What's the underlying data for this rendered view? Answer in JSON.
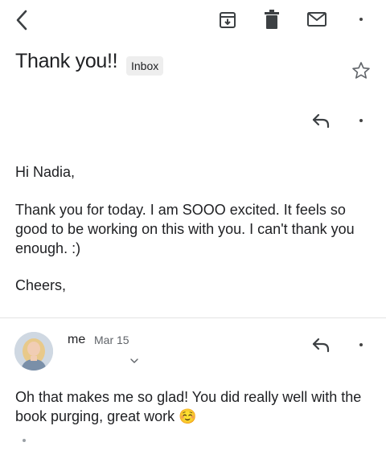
{
  "toolbar": {
    "back_icon": "chevron-left-icon",
    "archive_icon": "archive-icon",
    "delete_icon": "trash-icon",
    "mark_unread_icon": "envelope-icon",
    "more_icon": "more-horizontal-icon"
  },
  "thread": {
    "subject": "Thank you!!",
    "label": "Inbox"
  },
  "message1": {
    "greeting": "Hi Nadia,",
    "paragraph": "Thank you for today. I am SOOO excited. It feels so good to be working on this with you. I can't thank you enough. :)",
    "signoff": "Cheers,"
  },
  "message2": {
    "sender": "me",
    "date": "Mar 15",
    "body": "Oh that makes me so glad! You did really well with the book purging, great work ☺️"
  },
  "colors": {
    "text": "#202124",
    "icon": "#3c4043",
    "badge_bg": "#eeeeee",
    "divider": "#e3e3e3",
    "muted": "#5f6368"
  }
}
